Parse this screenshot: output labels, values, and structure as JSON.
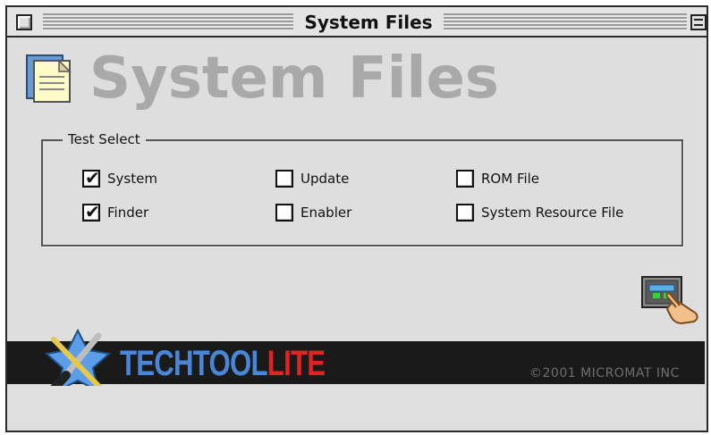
{
  "window": {
    "title": "System Files"
  },
  "header": {
    "title": "System Files",
    "icon": "documents-icon"
  },
  "test_select": {
    "label": "Test Select",
    "checkboxes": [
      {
        "label": "System",
        "checked": true
      },
      {
        "label": "Finder",
        "checked": true
      },
      {
        "label": "Update",
        "checked": false
      },
      {
        "label": "Enabler",
        "checked": false
      },
      {
        "label": "ROM File",
        "checked": false
      },
      {
        "label": "System Resource File",
        "checked": false
      }
    ]
  },
  "actions": {
    "start_test_icon": "hand-pressing-button-icon"
  },
  "banner": {
    "logo_icon": "screwdriver-wrench-icon",
    "brand_part1": "TECHTOOL",
    "brand_part2": "LITE",
    "copyright": "©2001 MICROMAT INC",
    "colors": {
      "tech": "#4a86d8",
      "lite": "#e02424",
      "background": "#1a1a1a"
    }
  }
}
